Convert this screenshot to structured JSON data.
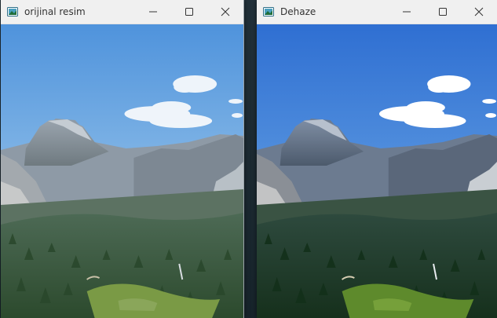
{
  "windows": [
    {
      "title": "orijinal resim",
      "icon": "app-icon",
      "controls": [
        "minimize-icon",
        "maximize-icon",
        "close-icon"
      ]
    },
    {
      "title": "Dehaze",
      "icon": "app-icon",
      "controls": [
        "minimize-icon",
        "maximize-icon",
        "close-icon"
      ]
    }
  ],
  "colors": {
    "titlebar": "#f0f0f0",
    "sky_original": "#6aa6dd",
    "sky_dehazed": "#3f7fd4"
  }
}
